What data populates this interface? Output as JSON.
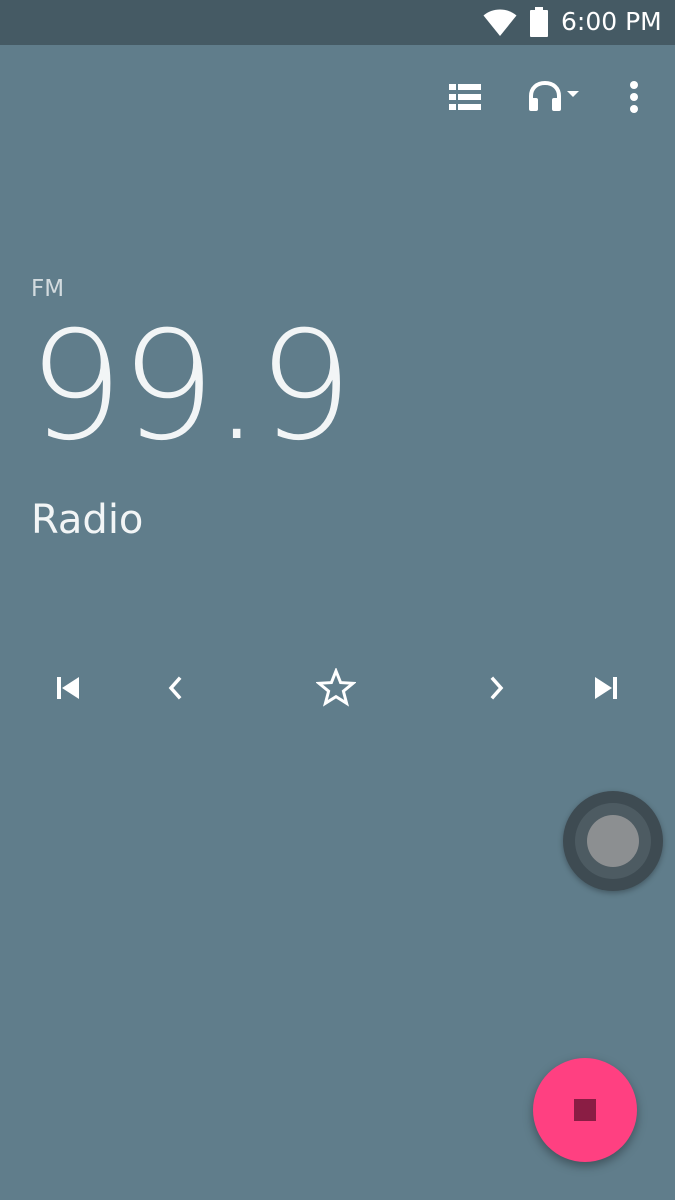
{
  "status_bar": {
    "time": "6:00 PM",
    "icons": [
      "wifi-icon",
      "battery-icon"
    ]
  },
  "toolbar": {
    "icons": [
      "station-list-icon",
      "headphones-icon",
      "dropdown-arrow-icon",
      "more-vert-icon"
    ]
  },
  "tuner": {
    "band": "FM",
    "frequency": "99.9",
    "station_name": "Radio"
  },
  "controls": {
    "icons": [
      "skip-previous-icon",
      "chevron-left-icon",
      "star-outline-icon",
      "chevron-right-icon",
      "skip-next-icon"
    ]
  },
  "fab": {
    "icon": "stop-icon",
    "color": "#ff4081"
  },
  "colors": {
    "background": "#607d8b",
    "status_bar": "#455a64",
    "accent": "#ff4081"
  }
}
